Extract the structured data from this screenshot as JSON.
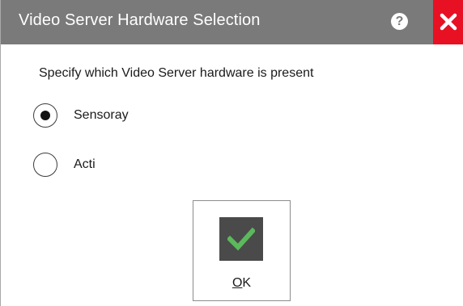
{
  "window": {
    "title": "Video Server Hardware Selection",
    "help_glyph": "?",
    "close_glyph": "✕",
    "titlebar_color": "#7a7a7a",
    "close_color": "#e81123"
  },
  "main": {
    "instruction": "Specify which Video Server hardware is present",
    "options": [
      {
        "label": "Sensoray",
        "selected": true
      },
      {
        "label": "Acti",
        "selected": false
      }
    ]
  },
  "ok_button": {
    "mnemonic": "O",
    "rest": "K",
    "icon": "checkmark-icon",
    "icon_color": "#5cb85c"
  }
}
